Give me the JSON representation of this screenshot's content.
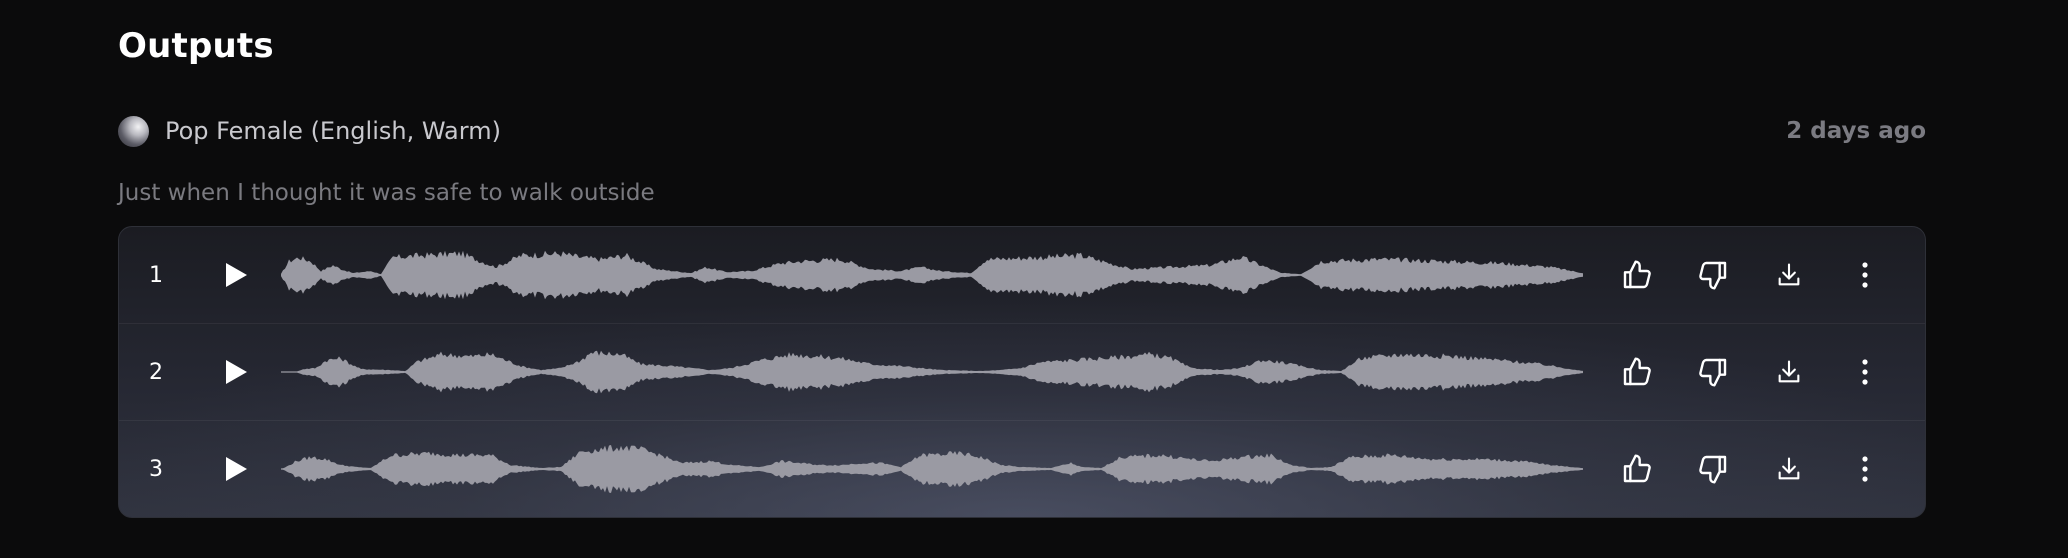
{
  "page": {
    "title": "Outputs"
  },
  "voice": {
    "name": "Pop Female (English, Warm)",
    "timestamp": "2 days ago"
  },
  "prompt": "Just when I thought it was safe to walk outside",
  "tracks": [
    {
      "number": "1"
    },
    {
      "number": "2"
    },
    {
      "number": "3"
    }
  ],
  "icons": {
    "play": "play-icon",
    "like": "thumbs-up-icon",
    "dislike": "thumbs-down-icon",
    "download": "download-icon",
    "more": "more-vertical-icon"
  },
  "colors": {
    "background": "#0b0b0c",
    "waveform": "#9a9aa3",
    "muted_text": "#7a7a80"
  }
}
